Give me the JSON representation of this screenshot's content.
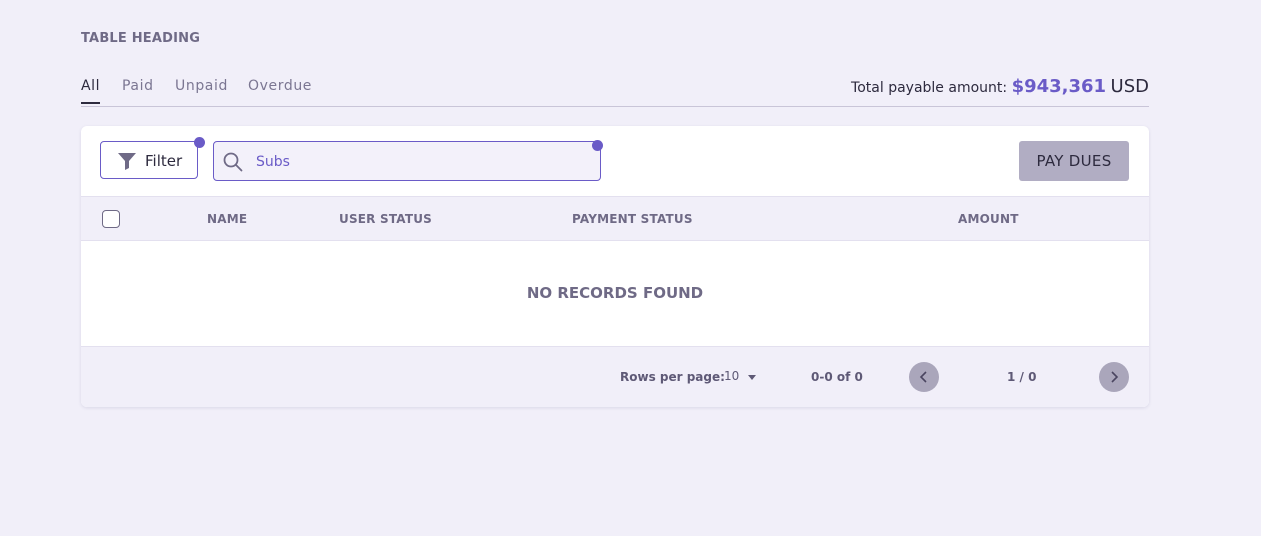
{
  "page": {
    "heading": "TABLE HEADING"
  },
  "tabs": [
    {
      "label": "All",
      "active": true
    },
    {
      "label": "Paid",
      "active": false
    },
    {
      "label": "Unpaid",
      "active": false
    },
    {
      "label": "Overdue",
      "active": false
    }
  ],
  "total": {
    "label": "Total payable amount:",
    "amount": "$943,361",
    "currency": "USD"
  },
  "toolbar": {
    "filter_label": "Filter",
    "search_value": "Subs",
    "pay_button_label": "PAY DUES"
  },
  "table": {
    "columns": [
      "NAME",
      "USER STATUS",
      "PAYMENT STATUS",
      "AMOUNT"
    ],
    "empty_message": "NO RECORDS FOUND"
  },
  "pagination": {
    "rows_per_page_label": "Rows per page:",
    "rows_per_page_value": "10",
    "range": "0-0 of 0",
    "page": "1 / 0"
  },
  "icons": {
    "filter": "filter-funnel-icon",
    "search": "search-icon",
    "prev": "chevron-left-icon",
    "next": "chevron-right-icon",
    "dropdown": "caret-down-icon"
  },
  "colors": {
    "accent": "#6a5bc7",
    "background": "#f1eff9",
    "button_disabled": "#b1adc3"
  }
}
